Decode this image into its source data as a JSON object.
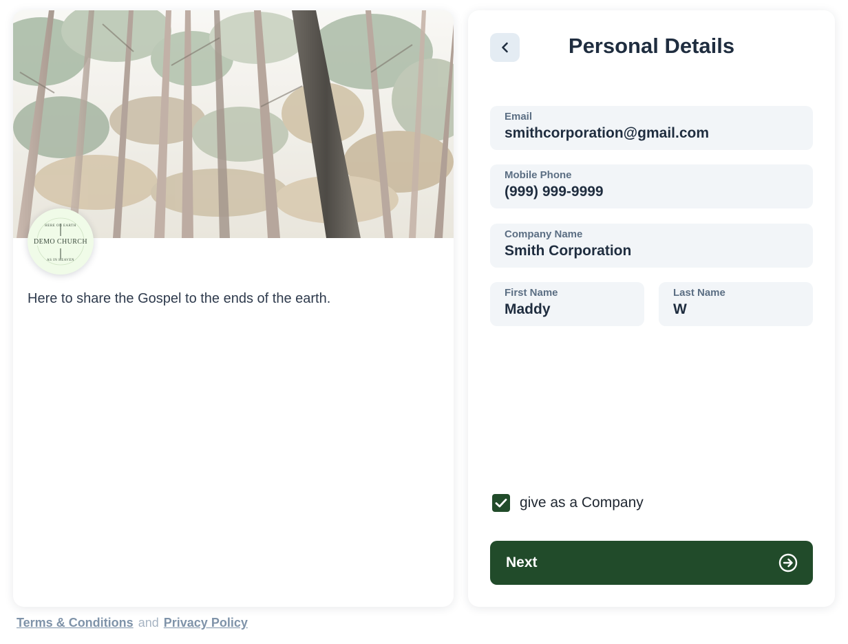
{
  "church": {
    "logo_text": "DEMO CHURCH",
    "logo_ring_top": "HERE ON EARTH",
    "logo_ring_bottom": "AS IN HEAVEN",
    "tagline": "Here to share the Gospel to the ends of the earth."
  },
  "form": {
    "title": "Personal Details",
    "fields": {
      "email": {
        "label": "Email",
        "value": "smithcorporation@gmail.com"
      },
      "phone": {
        "label": "Mobile Phone",
        "value": "(999) 999-9999"
      },
      "company": {
        "label": "Company Name",
        "value": "Smith Corporation"
      },
      "first_name": {
        "label": "First Name",
        "value": "Maddy"
      },
      "last_name": {
        "label": "Last Name",
        "value": "W"
      }
    },
    "give_as_company": {
      "label": "give as a Company",
      "checked": true
    },
    "next_label": "Next"
  },
  "footer": {
    "terms": "Terms & Conditions",
    "and": "and",
    "privacy": "Privacy Policy"
  },
  "icons": {
    "back": "chevron-left-icon",
    "check": "checkmark-icon",
    "next": "arrow-right-circle-icon"
  },
  "colors": {
    "accent": "#214b2a",
    "field_bg": "#f2f5f8",
    "back_button_bg": "#e4ecf3",
    "label": "#5b6e83",
    "text": "#1f2d3f",
    "footer_link": "#7f93a9",
    "logo_bg": "#f0fbe8"
  }
}
